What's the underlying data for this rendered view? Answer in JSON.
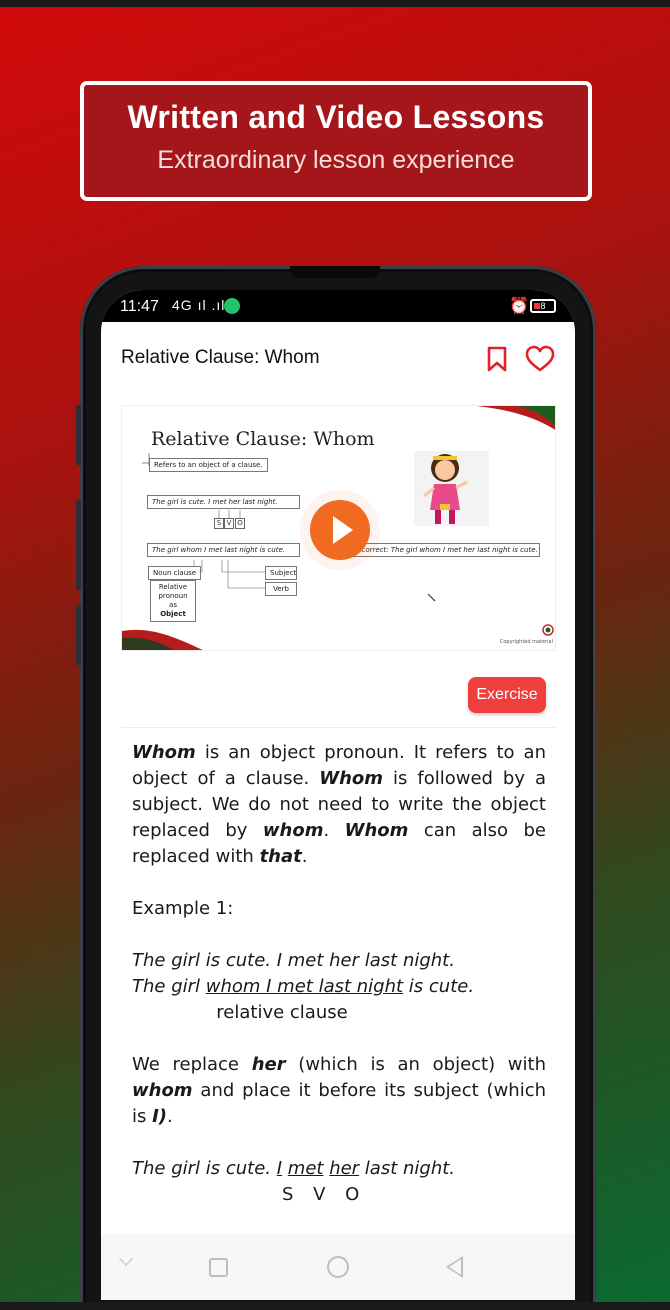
{
  "banner": {
    "title": "Written and Video Lessons",
    "subtitle": "Extraordinary lesson experience"
  },
  "status_bar": {
    "time": "11:47",
    "signal": "4G ıl .ıl",
    "battery": "8"
  },
  "header": {
    "title": "Relative Clause: Whom",
    "bookmark_icon": "bookmark-icon",
    "favorite_icon": "heart-icon"
  },
  "video": {
    "slide_title": "Relative Clause: Whom",
    "slide_note": "Refers to an object of a clause.",
    "sentence_1": "The girl is cute. I met her last night.",
    "svo": [
      "S",
      "V",
      "O"
    ],
    "sentence_2": "The girl whom I met last night is cute.",
    "incorrect": "Incorrect: The girl whom I met her last night is cute.",
    "noun_clause": "Noun clause",
    "relative_pronoun": [
      "Relative",
      "pronoun as",
      "Object"
    ],
    "subject": "Subject",
    "verb": "Verb",
    "copyright": "Copyrighted material",
    "play_icon": "play-icon"
  },
  "exercise_label": "Exercise",
  "lesson": {
    "p1": [
      {
        "t": "Whom",
        "s": "bi"
      },
      {
        "t": " is an object pronoun. It refers to an object of a clause. ",
        "s": ""
      },
      {
        "t": "Whom",
        "s": "bi"
      },
      {
        "t": " is followed by a subject. We do not need to write the object replaced by ",
        "s": ""
      },
      {
        "t": "whom",
        "s": "bi"
      },
      {
        "t": ". ",
        "s": ""
      },
      {
        "t": "Whom",
        "s": "bi"
      },
      {
        "t": " can also be replaced with ",
        "s": ""
      },
      {
        "t": "that",
        "s": "bi"
      },
      {
        "t": ".",
        "s": ""
      }
    ],
    "example_label": "Example 1:",
    "ex_line1": "The girl is cute. I met her last night.",
    "ex_line2": [
      {
        "t": "The girl ",
        "s": "i"
      },
      {
        "t": "whom I met last night",
        "s": "iu"
      },
      {
        "t": " is cute.",
        "s": "i"
      }
    ],
    "ex_caption": "relative clause",
    "p2": [
      {
        "t": "We replace ",
        "s": ""
      },
      {
        "t": "her",
        "s": "bi"
      },
      {
        "t": " (which is an object) with ",
        "s": ""
      },
      {
        "t": "whom",
        "s": "bi"
      },
      {
        "t": " and place it before its subject (which is ",
        "s": ""
      },
      {
        "t": "I)",
        "s": "bi"
      },
      {
        "t": ".",
        "s": ""
      }
    ],
    "ex_line3": [
      {
        "t": "The girl is cute. ",
        "s": "i"
      },
      {
        "t": "I",
        "s": "iu"
      },
      {
        "t": "  ",
        "s": "i"
      },
      {
        "t": "met",
        "s": "iu"
      },
      {
        "t": " ",
        "s": "i"
      },
      {
        "t": "her",
        "s": "iu"
      },
      {
        "t": " last night.",
        "s": "i"
      }
    ],
    "svo_row": "S V O"
  },
  "nav_bar": {
    "icons": [
      "chevron-down-icon",
      "recents-icon",
      "home-icon",
      "back-icon"
    ]
  },
  "colors": {
    "accent": "#ef3e3e",
    "play": "#f06a22",
    "banner_fill": "#a5161a"
  }
}
